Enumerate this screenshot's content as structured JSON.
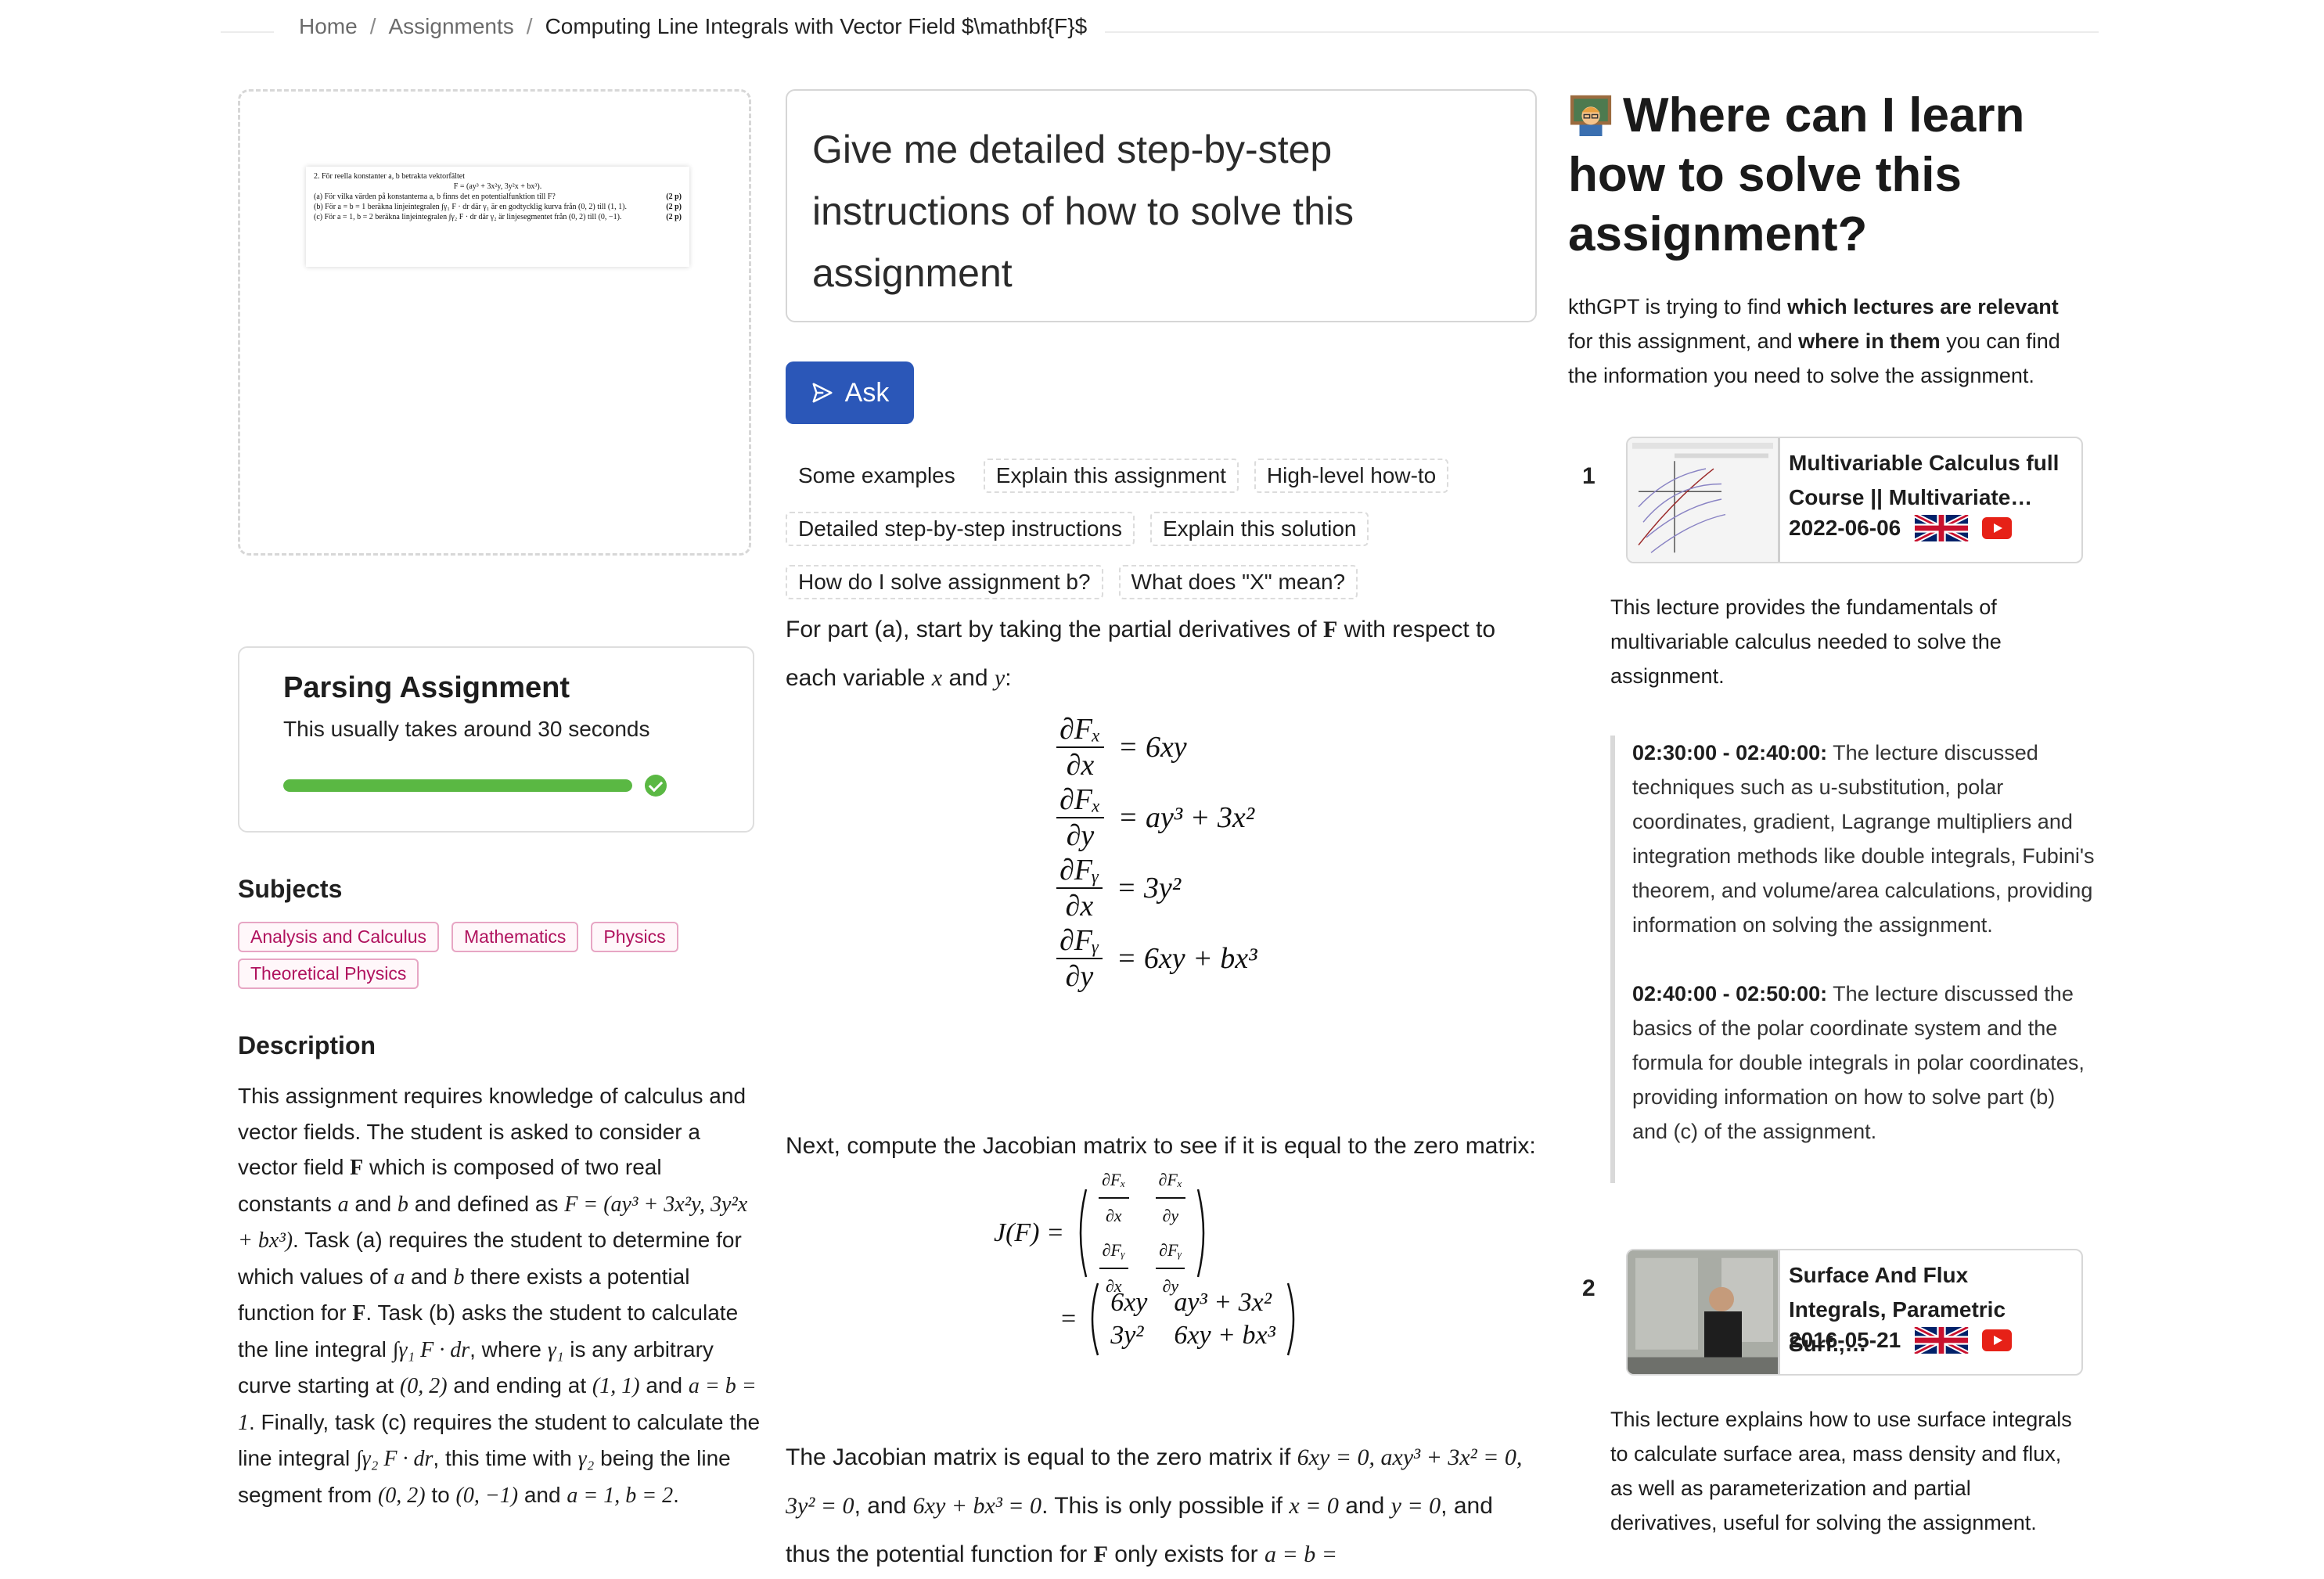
{
  "breadcrumb": {
    "home": "Home",
    "assignments": "Assignments",
    "current": "Computing Line Integrals with Vector Field $\\mathbf{F}$"
  },
  "assignment_image": {
    "line1": "2. För reella konstanter a, b betrakta vektorfältet",
    "line2": "F = (ay³ + 3x²y, 3y²x + bx³).",
    "a_text": "(a) För vilka värden på konstanterna a, b finns det en potentialfunktion till F?",
    "a_pts": "(2 p)",
    "b_text": "(b) För a = b = 1 beräkna linjeintegralen ∫γ₁ F · dr där γ₁ är en godtycklig kurva från (0, 2) till (1, 1).",
    "b_pts": "(2 p)",
    "c_text": "(c) För a = 1, b = 2 beräkna linjeintegralen ∫γ₂ F · dr där γ₂ är linjesegmentet från (0, 2) till (0, −1).",
    "c_pts": "(2 p)"
  },
  "parsing": {
    "title": "Parsing Assignment",
    "subtitle": "This usually takes around 30 seconds",
    "progress": 1.0,
    "status": "complete"
  },
  "subjects": {
    "heading": "Subjects",
    "items": [
      "Analysis and Calculus",
      "Mathematics",
      "Physics",
      "Theoretical Physics"
    ]
  },
  "description": {
    "heading": "Description",
    "p1": "This assignment requires knowledge of calculus and vector fields. The student is asked to consider a vector field ",
    "F": "F",
    "p2": " which is composed of two real constants ",
    "a": "a",
    "p3": " and ",
    "b": "b",
    "p4": " and defined as ",
    "F_def": "F = (ay³ + 3x²y, 3y²x + bx³)",
    "p5": ". Task (a) requires the student to determine for which values of ",
    "p6": " there exists a potential function for ",
    "p7": ". Task (b) asks the student to calculate the line integral ",
    "int1": "∫γ₁ F · dr",
    "p8": ", where ",
    "gamma1": "γ₁",
    "p9": " is any arbitrary curve starting at ",
    "pt1": "(0, 2)",
    "p10": " and ending at ",
    "pt2": "(1, 1)",
    "p11": " and ",
    "ab1": "a = b = 1",
    "p12": ". Finally, task (c) requires the student to calculate the line integral ",
    "int2": "∫γ₂ F · dr",
    "p13": ", this time with ",
    "gamma2": "γ₂",
    "p14": " being the line segment from ",
    "pt3": "(0, 2)",
    "p15": " to ",
    "pt4": "(0, −1)",
    "ab2": "a = 1, b = 2",
    "p16": "."
  },
  "prompt": {
    "text": "Give me detailed step-by-step instructions of how to solve this assignment"
  },
  "ask_button": {
    "label": "Ask"
  },
  "examples": {
    "label": "Some examples",
    "items": [
      "Explain this assignment",
      "High-level how-to",
      "Detailed step-by-step instructions",
      "Explain this solution",
      "How do I solve assignment b?",
      "What does \"X\" mean?"
    ]
  },
  "answer": {
    "p1a": "For part (a), start by taking the partial derivatives of ",
    "p1F": "F",
    "p1b": " with respect to each variable ",
    "p1x": "x",
    "p1c": " and ",
    "p1y": "y",
    "p1d": ":",
    "derivs": [
      {
        "num": "∂Fₓ",
        "den": "∂x",
        "rhs": "= 6xy"
      },
      {
        "num": "∂Fₓ",
        "den": "∂y",
        "rhs": "= ay³ + 3x²"
      },
      {
        "num": "∂Fᵧ",
        "den": "∂x",
        "rhs": "= 3y²"
      },
      {
        "num": "∂Fᵧ",
        "den": "∂y",
        "rhs": "= 6xy + bx³"
      }
    ],
    "p2": "Next, compute the Jacobian matrix to see if it is equal to the zero matrix:",
    "jac_lhs": "J(F) =",
    "jac_m": [
      [
        "∂Fₓ",
        "∂x",
        "∂Fₓ",
        "∂y"
      ],
      [
        "∂Fᵧ",
        "∂x",
        "∂Fᵧ",
        "∂y"
      ]
    ],
    "jac_eq": "=",
    "jac_r": [
      [
        "6xy",
        "ay³ + 3x²"
      ],
      [
        "3y²",
        "6xy + bx³"
      ]
    ],
    "p3a": "The Jacobian matrix is equal to the zero matrix if ",
    "p3m1": "6xy = 0, axy³ + 3x² = 0, 3y² = 0",
    "p3b": ", and ",
    "p3m2": "6xy + bx³ = 0",
    "p3c": ". This is only possible if ",
    "p3m3": "x = 0",
    "p3d": " and ",
    "p3m4": "y = 0",
    "p3e": ", and thus the potential function for ",
    "p3F": "F",
    "p3f": " only exists for ",
    "p3m5": "a = b ="
  },
  "learn": {
    "heading": "Where can I learn how to solve this assignment?",
    "intro_a": "kthGPT is trying to find ",
    "intro_b": "which lectures are relevant",
    "intro_c": " for this assignment, and ",
    "intro_d": "where in them",
    "intro_e": " you can find the information you need to solve the assignment.",
    "lectures": [
      {
        "rank": "1",
        "title": "Multivariable Calculus full Course || Multivariate…",
        "date": "2022-06-06",
        "summary": "This lecture provides the fundamentals of multivariable calculus needed to solve the assignment.",
        "segments": [
          {
            "time": "02:30:00 - 02:40:00:",
            "text": " The lecture discussed techniques such as u-substitution, polar coordinates, gradient, Lagrange multipliers and integration methods like double integrals, Fubini's theorem, and volume/area calculations, providing information on solving the assignment."
          },
          {
            "time": "02:40:00 - 02:50:00:",
            "text": " The lecture discussed the basics of the polar coordinate system and the formula for double integrals in polar coordinates, providing information on how to solve part (b) and (c) of the assignment."
          }
        ]
      },
      {
        "rank": "2",
        "title": "Surface And Flux Integrals, Parametric Surf.,…",
        "date": "2016-05-21",
        "summary": "This lecture explains how to use surface integrals to calculate surface area, mass density and flux, as well as parameterization and partial derivatives, useful for solving the assignment."
      }
    ]
  },
  "colors": {
    "accent": "#2b57b8",
    "progress": "#5ab843",
    "chip_border": "#e7a6c4",
    "chip_text": "#b0125e",
    "youtube": "#e62117"
  }
}
